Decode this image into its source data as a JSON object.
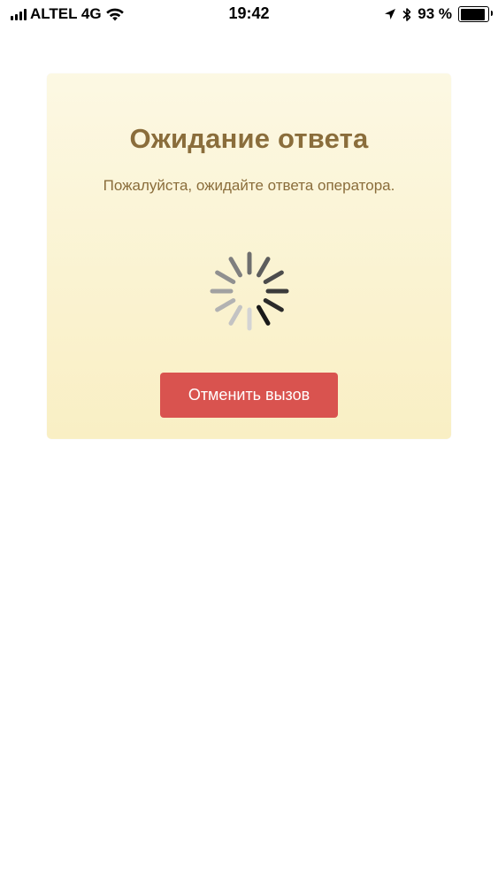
{
  "status_bar": {
    "carrier": "ALTEL 4G",
    "time": "19:42",
    "battery_text": "93 %",
    "battery_level": 0.93,
    "icons": [
      "signal-icon",
      "wifi-icon",
      "location-icon",
      "bluetooth-icon",
      "battery-icon"
    ]
  },
  "dialog": {
    "title": "Ожидание ответа",
    "message": "Пожалуйста, ожидайте ответа оператора.",
    "cancel_label": "Отменить вызов",
    "colors": {
      "text": "#8a6d3b",
      "background_top": "#fcf8e3",
      "background_bottom": "#f9efc4",
      "button": "#d9534f",
      "button_text": "#ffffff"
    },
    "spinner_icon": "loading-spinner-icon"
  }
}
